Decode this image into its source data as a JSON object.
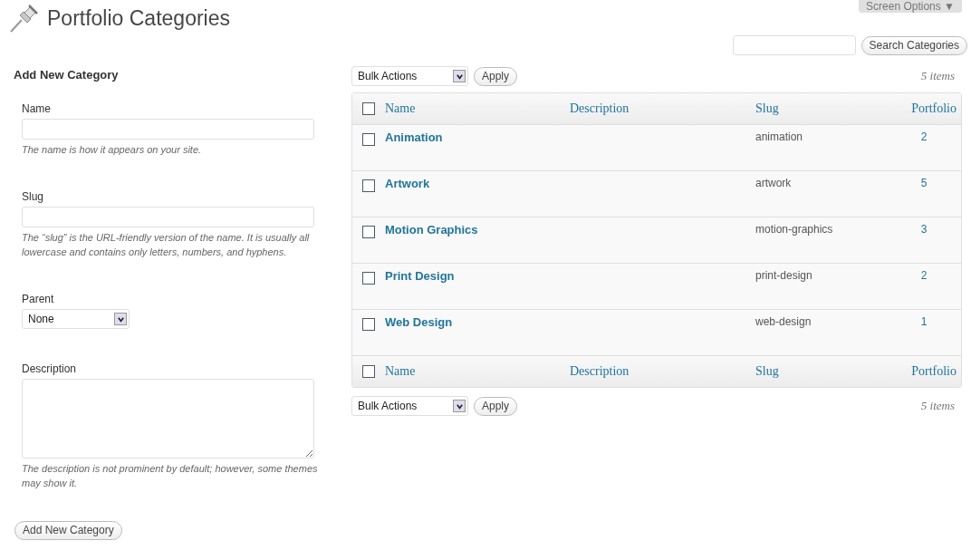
{
  "page": {
    "title": "Portfolio Categories",
    "screen_options": "Screen Options ▼"
  },
  "search": {
    "button": "Search Categories"
  },
  "form": {
    "heading": "Add New Category",
    "fields": [
      {
        "kind": "text",
        "label": "Name",
        "hint": "The name is how it appears on your site."
      },
      {
        "kind": "text",
        "label": "Slug",
        "hint": "The “slug” is the URL-friendly version of the name. It is usually all lowercase and contains only letters, numbers, and hyphens."
      },
      {
        "kind": "select",
        "label": "Parent",
        "value": "None"
      },
      {
        "kind": "textarea",
        "label": "Description",
        "hint": "The description is not prominent by default; however, some themes may show it."
      }
    ],
    "submit": "Add New Category"
  },
  "table": {
    "top_nav": {
      "bulk_actions": "Bulk Actions",
      "apply": "Apply",
      "count": "5 items"
    },
    "header": {
      "checked": false,
      "columns": [
        "Name",
        "Description",
        "Slug",
        "Portfolio"
      ]
    },
    "rows": [
      {
        "checked": false,
        "name": "Animation",
        "slug": "animation",
        "count": "2"
      },
      {
        "checked": false,
        "name": "Artwork",
        "slug": "artwork",
        "count": "5"
      },
      {
        "checked": false,
        "name": "Motion Graphics",
        "slug": "motion-graphics",
        "count": "3"
      },
      {
        "checked": false,
        "name": "Print Design",
        "slug": "print-design",
        "count": "2"
      },
      {
        "checked": false,
        "name": "Web Design",
        "slug": "web-design",
        "count": "1"
      }
    ],
    "footer": {
      "checked": false,
      "columns": [
        "Name",
        "Description",
        "Slug",
        "Portfolio"
      ]
    },
    "bottom_nav": {
      "bulk_actions": "Bulk Actions",
      "apply": "Apply",
      "count": "5 items"
    }
  }
}
